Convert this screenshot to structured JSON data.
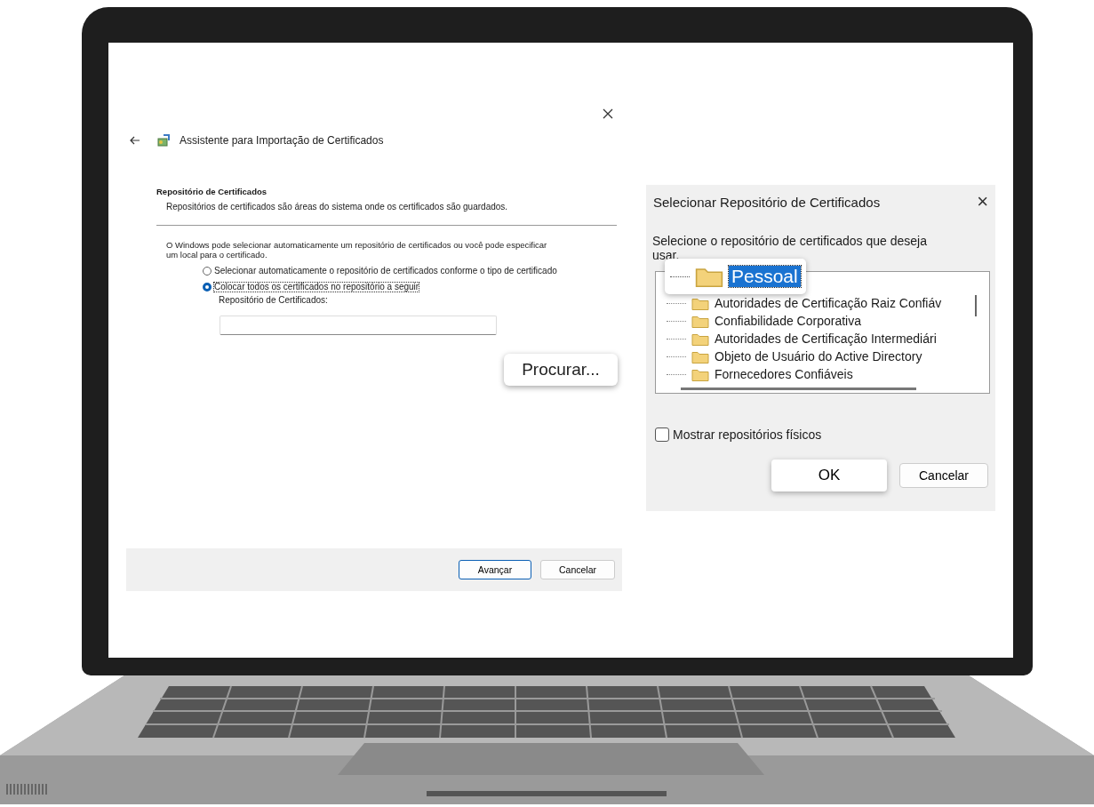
{
  "wizard": {
    "title": "Assistente para Importação de Certificados",
    "heading": "Repositório de Certificados",
    "description": "Repositórios de certificados são áreas do sistema onde os certificados são guardados.",
    "intro": "O Windows pode selecionar automaticamente um repositório de certificados ou você pode especificar um local para o certificado.",
    "options": [
      {
        "label": "Selecionar automaticamente o repositório de certificados conforme o tipo de certificado",
        "selected": false
      },
      {
        "label": "Colocar todos os certificados no repositório a seguir",
        "selected": true
      }
    ],
    "store_label": "Repositório de Certificados:",
    "browse_button": "Procurar...",
    "buttons": [
      {
        "label": "Avançar",
        "default": true
      },
      {
        "label": "Cancelar",
        "default": false
      }
    ]
  },
  "store_dialog": {
    "title": "Selecionar Repositório de Certificados",
    "close": "×",
    "prompt": "Selecione o repositório de certificados que deseja usar.",
    "stores": [
      {
        "label": "Pessoal",
        "selected": true
      },
      {
        "label": "Autoridades de Certificação Raiz Confiáv",
        "selected": false
      },
      {
        "label": "Confiabilidade Corporativa",
        "selected": false
      },
      {
        "label": "Autoridades de Certificação Intermediári",
        "selected": false
      },
      {
        "label": "Objeto de Usuário do Active Directory",
        "selected": false
      },
      {
        "label": "Fornecedores Confiáveis",
        "selected": false
      }
    ],
    "show_physical": {
      "label": "Mostrar repositórios físicos",
      "checked": false
    },
    "buttons": [
      {
        "label": "OK",
        "default": true
      },
      {
        "label": "Cancelar",
        "default": false
      }
    ]
  }
}
